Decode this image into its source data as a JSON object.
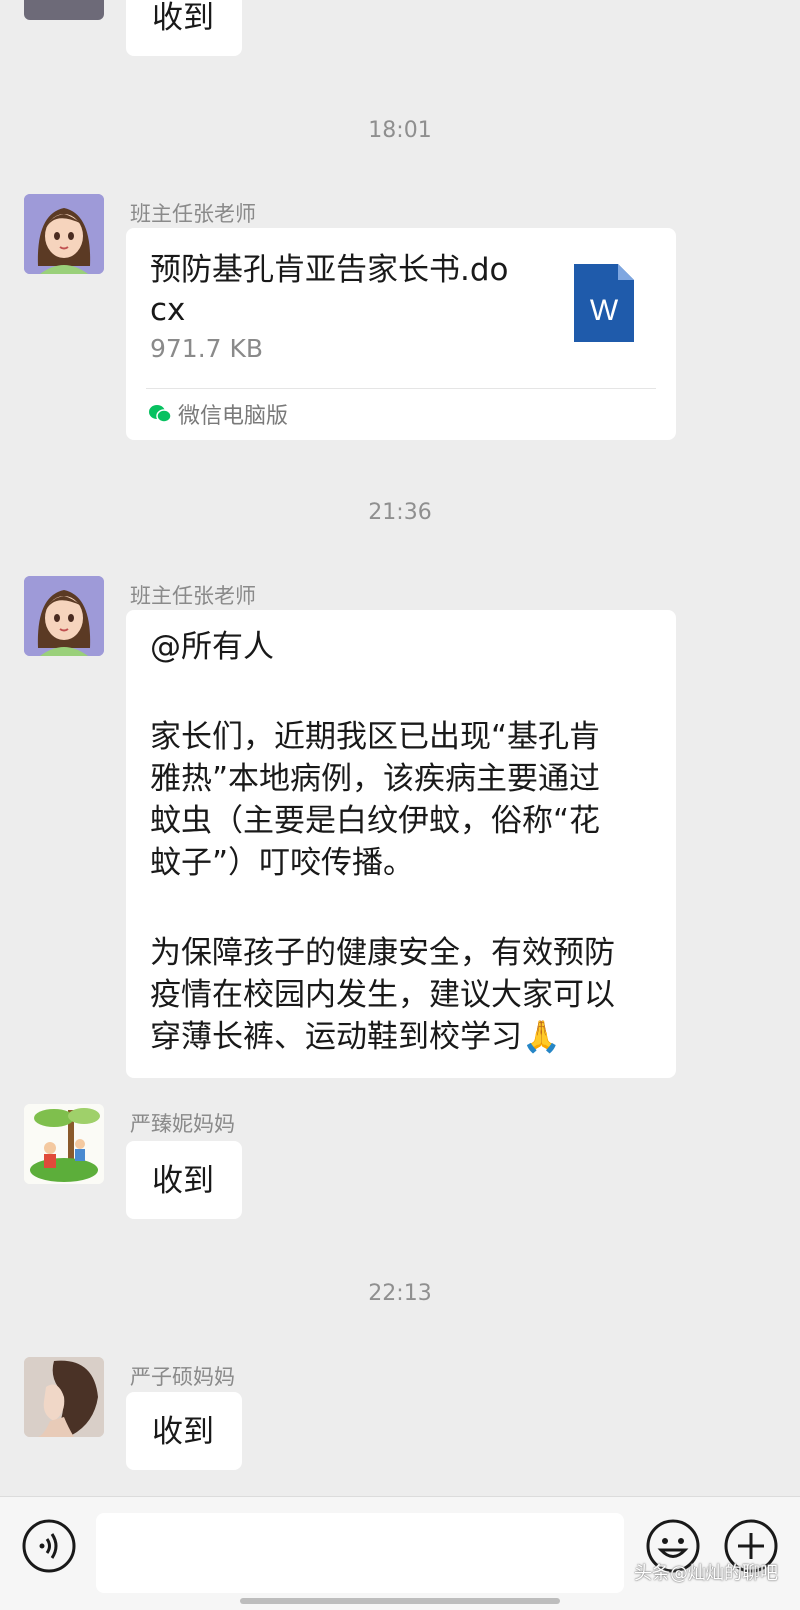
{
  "messages": {
    "top_reply": "收到",
    "time_1": "18:01",
    "teacher_name": "班主任张老师",
    "file": {
      "name": "预防基孔肯亚告家长书.docx",
      "size": "971.7 KB",
      "icon_letter": "W",
      "source": "微信电脑版",
      "icon": "word-doc-icon"
    },
    "time_2": "21:36",
    "notice": {
      "line1": "@所有人",
      "line2": "家长们，近期我区已出现“基孔肯",
      "line3": "雅热”本地病例，该疾病主要通过",
      "line4": "蚊虫（主要是白纹伊蚊，俗称“花",
      "line5": "蚊子”）叮咬传播。",
      "line6": "为保障孩子的健康安全，有效预防",
      "line7": "疫情在校园内发生，建议大家可以",
      "line8": "穿薄长裤、运动鞋到校学习",
      "emoji": "🙏"
    },
    "parent1_name": "严臻妮妈妈",
    "parent1_reply": "收到",
    "time_3": "22:13",
    "parent2_name": "严子硕妈妈",
    "parent2_reply": "收到"
  },
  "input_bar": {
    "voice_icon": "voice-icon",
    "emoji_icon": "emoji-icon",
    "plus_icon": "plus-icon",
    "watermark": "头条@灿灿的聊吧"
  },
  "colors": {
    "background": "#ededed",
    "bubble": "#ffffff",
    "word_blue": "#1f5bab",
    "wechat_green": "#07c160"
  }
}
